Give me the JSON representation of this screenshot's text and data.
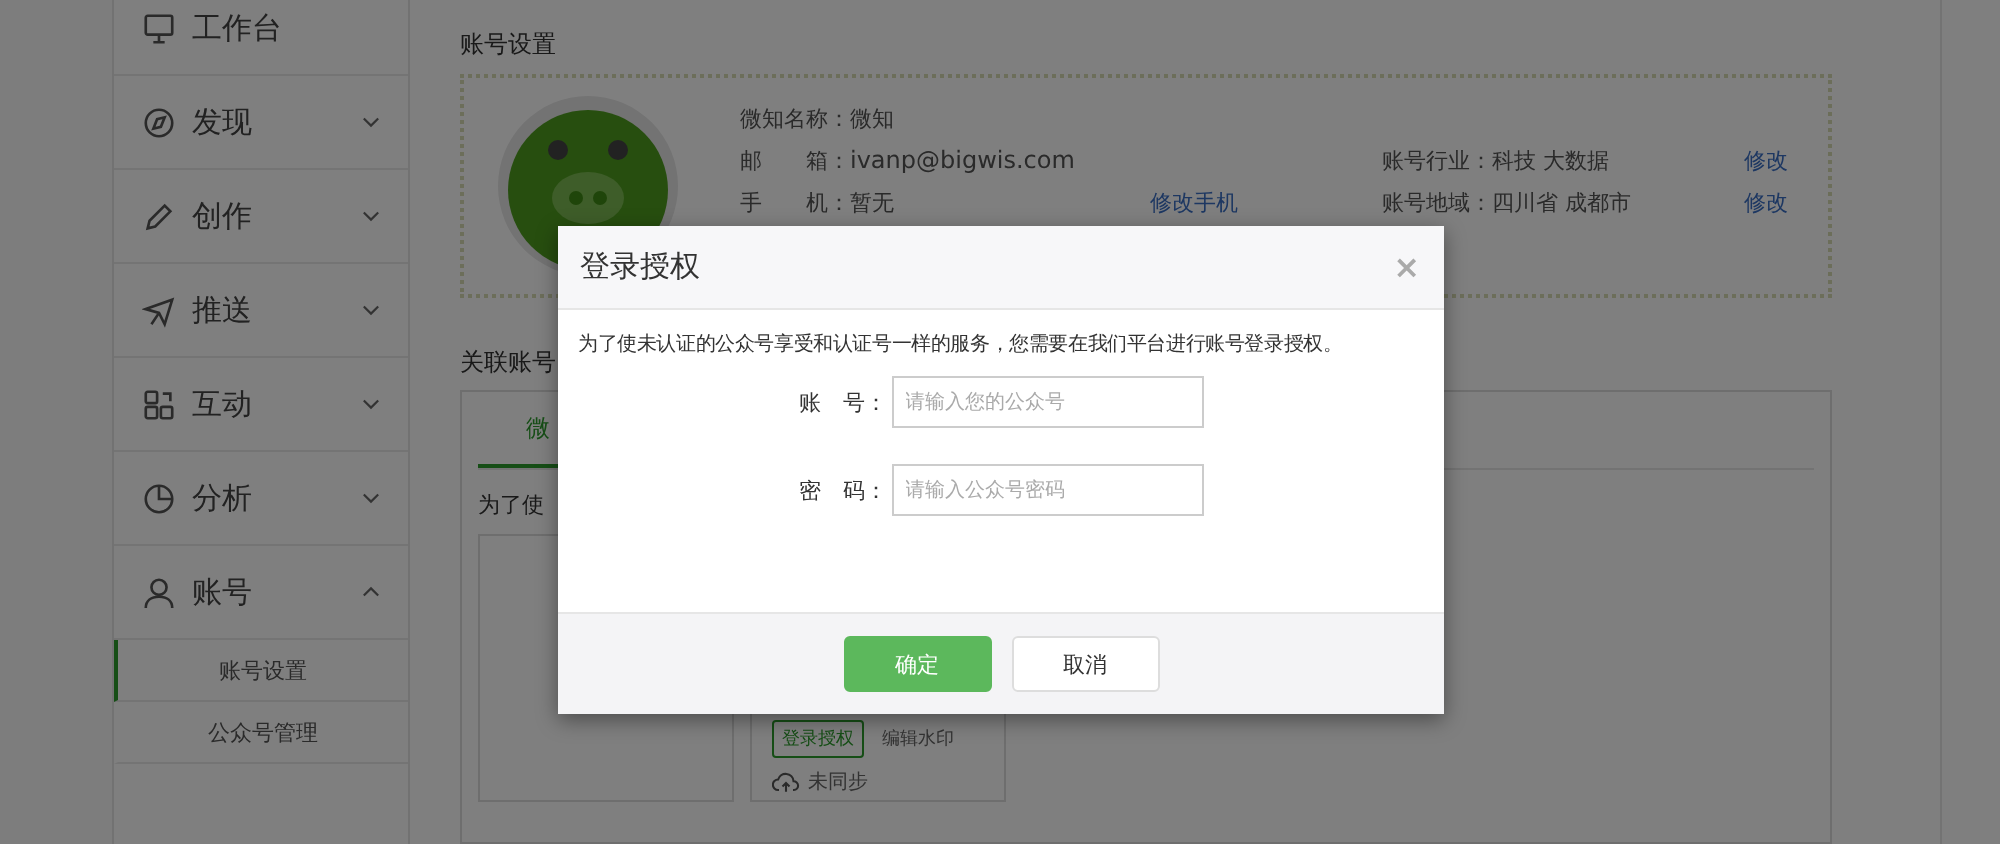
{
  "sidebar": {
    "items": [
      {
        "label": "工作台",
        "kind": "link"
      },
      {
        "label": "发现",
        "kind": "group",
        "expanded": false
      },
      {
        "label": "创作",
        "kind": "group",
        "expanded": false
      },
      {
        "label": "推送",
        "kind": "group",
        "expanded": false
      },
      {
        "label": "互动",
        "kind": "group",
        "expanded": false
      },
      {
        "label": "分析",
        "kind": "group",
        "expanded": false
      },
      {
        "label": "账号",
        "kind": "group",
        "expanded": true,
        "children": [
          {
            "label": "账号设置",
            "selected": true
          },
          {
            "label": "公众号管理",
            "selected": false
          }
        ]
      }
    ]
  },
  "account": {
    "title": "账号设置",
    "name": {
      "label": "微知名称：",
      "value": "微知"
    },
    "email": {
      "label": "邮　　箱：",
      "value": "ivanp@bigwis.com"
    },
    "phone": {
      "label": "手　　机：",
      "value": "暂无",
      "action": "修改手机"
    },
    "industry": {
      "label": "账号行业：",
      "value": "科技  大数据",
      "action": "修改"
    },
    "region": {
      "label": "账号地域：",
      "value": "四川省  成都市",
      "action": "修改"
    }
  },
  "linked": {
    "title": "关联账号",
    "tabs": [
      {
        "label": "微",
        "selected": true
      }
    ],
    "note": "为了使",
    "card": {
      "buttons": [
        {
          "label": "登录授权",
          "kind": "primary"
        },
        {
          "label": "编辑水印",
          "kind": "plain"
        }
      ],
      "status": "未同步"
    }
  },
  "dialog": {
    "title": "登录授权",
    "close": "×",
    "description": "为了使未认证的公众号享受和认证号一样的服务，您需要在我们平台进行账号登录授权。",
    "fields": [
      {
        "label": "账　号：",
        "placeholder": "请输入您的公众号"
      },
      {
        "label": "密　码：",
        "placeholder": "请输入公众号密码"
      }
    ],
    "buttons": [
      {
        "label": "确定",
        "kind": "primary"
      },
      {
        "label": "取消",
        "kind": "plain"
      }
    ]
  }
}
